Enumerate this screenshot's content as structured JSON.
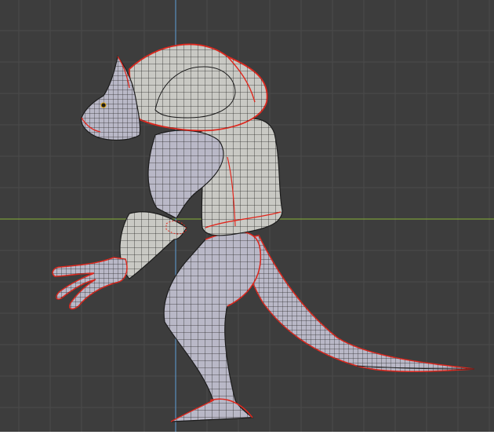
{
  "viewport": {
    "background_color": "#3d3d3d",
    "grid_line_color": "#4a4a4a",
    "x_axis_color": "#7a9a3a",
    "z_axis_color": "#5b8fbf",
    "view": "side-orthographic",
    "mode": "edit-mode-wireframe-overlay"
  },
  "mesh": {
    "name": "",
    "subject": "creature-character",
    "surface_color": "#b9b8c7",
    "shell_color": "#c9c9c4",
    "wire_color": "#1c1c1c",
    "seam_color": "#e0281e",
    "selected_vertices": true
  }
}
